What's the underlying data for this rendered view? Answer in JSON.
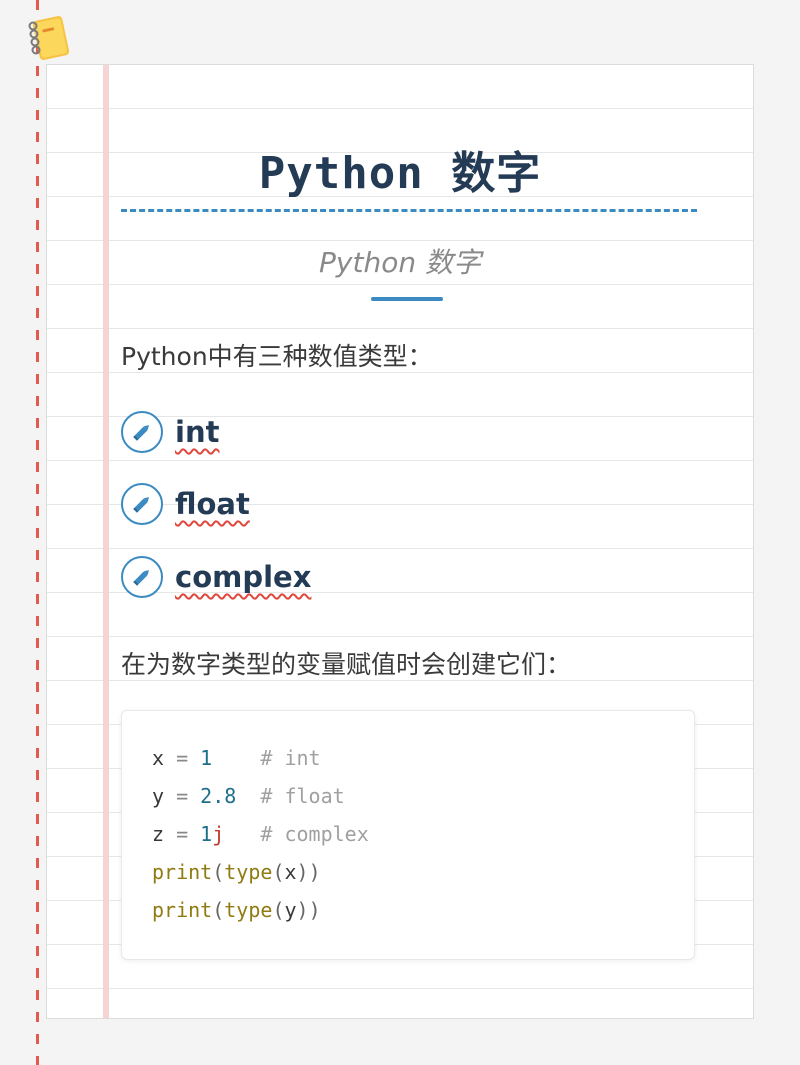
{
  "title": "Python 数字",
  "subtitle": "Python 数字",
  "intro": "Python中有三种数值类型：",
  "types": [
    {
      "label": "int"
    },
    {
      "label": "float"
    },
    {
      "label": "complex"
    }
  ],
  "assign_intro": "在为数字类型的变量赋值时会创建它们：",
  "code": {
    "lines": [
      {
        "var": "x",
        "op": " = ",
        "num": "1",
        "suffix": "",
        "pad": "    ",
        "comment": "# int"
      },
      {
        "var": "y",
        "op": " = ",
        "num": "2.8",
        "suffix": "",
        "pad": "  ",
        "comment": "# float"
      },
      {
        "var": "z",
        "op": " = ",
        "num": "1",
        "suffix": "j",
        "pad": "   ",
        "comment": "# complex"
      }
    ],
    "calls": [
      {
        "fn": "print",
        "inner_fn": "type",
        "arg": "x"
      },
      {
        "fn": "print",
        "inner_fn": "type",
        "arg": "y"
      }
    ]
  },
  "colors": {
    "accent": "#3b8bc2",
    "title": "#243b55",
    "margin_dash": "#e05a4f",
    "wavy_underline": "#e0483e"
  },
  "icons": {
    "corner": "notepad-icon",
    "list_marker": "pencil-icon"
  }
}
